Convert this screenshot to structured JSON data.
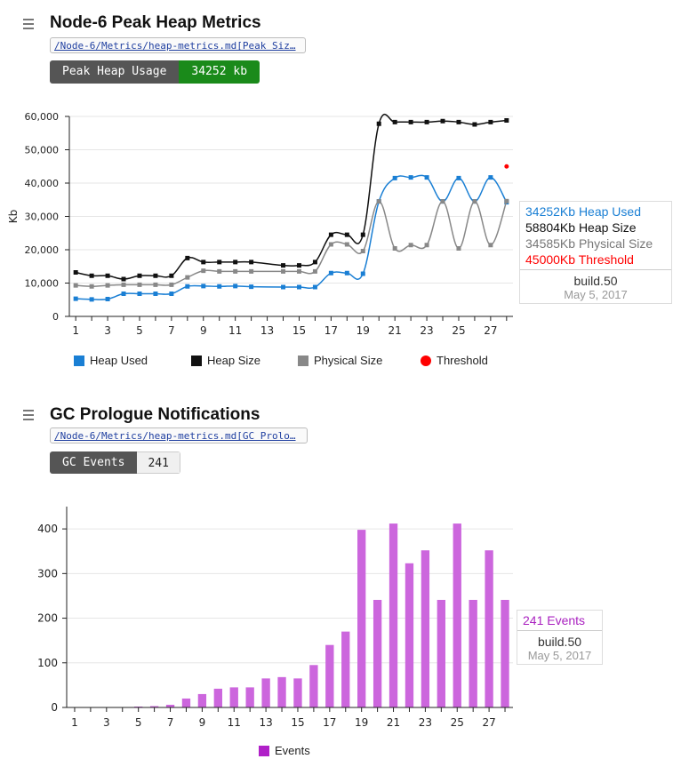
{
  "heap_panel": {
    "title": "Node-6 Peak Heap Metrics",
    "link_text": "/Node-6/Metrics/heap-metrics.md[Peak Siz…",
    "badge_label": "Peak Heap Usage",
    "badge_value": "34252 kb",
    "tooltip": {
      "heap_used": "34252Kb Heap Used",
      "heap_size": "58804Kb Heap Size",
      "physical_size": "34585Kb Physical Size",
      "threshold": "45000Kb Threshold",
      "build": "build.50",
      "date": "May 5, 2017"
    }
  },
  "gc_panel": {
    "title": "GC Prologue Notifications",
    "link_text": "/Node-6/Metrics/heap-metrics.md[GC Prolo…",
    "badge_label": "GC Events",
    "badge_value": "241",
    "tooltip": {
      "events": "241 Events",
      "build": "build.50",
      "date": "May 5, 2017"
    }
  },
  "colors": {
    "heap_used": "#1a7fd4",
    "heap_size": "#111111",
    "physical_size": "#888888",
    "threshold": "#ff0000",
    "events": "#cc66dd",
    "events_legend": "#b020c8"
  },
  "chart_data": [
    {
      "type": "line",
      "ylabel": "Kb",
      "ylim": [
        0,
        60000
      ],
      "yticks": [
        "0",
        "10,000",
        "20,000",
        "30,000",
        "40,000",
        "50,000",
        "60,000"
      ],
      "x": [
        1,
        2,
        3,
        4,
        5,
        6,
        7,
        8,
        9,
        10,
        11,
        12,
        13,
        14,
        15,
        16,
        17,
        18,
        19,
        20,
        21,
        22,
        23,
        24,
        25,
        26,
        27,
        28
      ],
      "xtick_labels": [
        "1",
        "3",
        "5",
        "7",
        "9",
        "11",
        "13",
        "15",
        "17",
        "19",
        "21",
        "23",
        "25",
        "27"
      ],
      "series": [
        {
          "name": "Heap Used",
          "values": [
            5300,
            5100,
            5200,
            6800,
            6800,
            6800,
            6800,
            9000,
            9100,
            9000,
            9100,
            8900,
            null,
            8800,
            8800,
            8800,
            13000,
            13000,
            12800,
            34500,
            41500,
            41700,
            41700,
            34500,
            41500,
            34500,
            41700,
            34252
          ]
        },
        {
          "name": "Heap Size",
          "values": [
            13200,
            12200,
            12200,
            11200,
            12200,
            12200,
            12200,
            17500,
            16300,
            16300,
            16300,
            16300,
            null,
            15300,
            15300,
            16300,
            24500,
            24500,
            24500,
            57800,
            58300,
            58300,
            58300,
            58600,
            58300,
            57600,
            58300,
            58804
          ]
        },
        {
          "name": "Physical Size",
          "values": [
            9300,
            9000,
            9300,
            9500,
            9500,
            9500,
            9500,
            11700,
            13700,
            13500,
            13500,
            13500,
            null,
            13500,
            13500,
            13500,
            21600,
            21600,
            19600,
            34500,
            20400,
            21400,
            21400,
            34500,
            20400,
            34500,
            21400,
            34585
          ]
        },
        {
          "name": "Threshold",
          "values": [
            null,
            null,
            null,
            null,
            null,
            null,
            null,
            null,
            null,
            null,
            null,
            null,
            null,
            null,
            null,
            null,
            null,
            null,
            null,
            null,
            null,
            null,
            null,
            null,
            null,
            null,
            null,
            45000
          ]
        }
      ],
      "legend_position": "bottom",
      "grid": true
    },
    {
      "type": "bar",
      "ylim": [
        0,
        450
      ],
      "yticks": [
        "0",
        "100",
        "200",
        "300",
        "400"
      ],
      "x": [
        1,
        2,
        3,
        4,
        5,
        6,
        7,
        8,
        9,
        10,
        11,
        12,
        13,
        14,
        15,
        16,
        17,
        18,
        19,
        20,
        21,
        22,
        23,
        24,
        25,
        26,
        27,
        28
      ],
      "xtick_labels": [
        "1",
        "3",
        "5",
        "7",
        "9",
        "11",
        "13",
        "15",
        "17",
        "19",
        "21",
        "23",
        "25",
        "27"
      ],
      "series": [
        {
          "name": "Events",
          "values": [
            0,
            0,
            0,
            1,
            2,
            3,
            6,
            20,
            30,
            42,
            45,
            45,
            65,
            68,
            65,
            95,
            140,
            170,
            398,
            241,
            412,
            323,
            352,
            241,
            412,
            241,
            352,
            241
          ]
        }
      ],
      "legend_position": "bottom",
      "grid": true
    }
  ]
}
